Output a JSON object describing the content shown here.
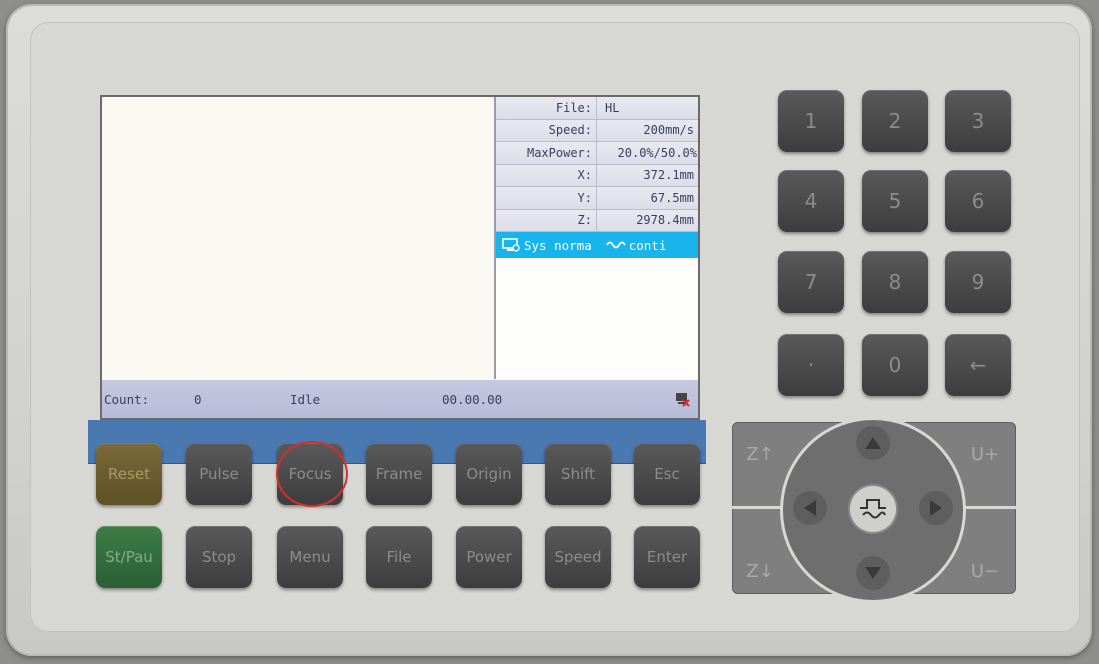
{
  "screen": {
    "info": [
      {
        "label": "File:",
        "value": "HL",
        "align": "left"
      },
      {
        "label": "Speed:",
        "value": "200mm/s"
      },
      {
        "label": "MaxPower:",
        "value": "20.0%/50.0%"
      },
      {
        "label": "X:",
        "value": "372.1mm"
      },
      {
        "label": "Y:",
        "value": "67.5mm"
      },
      {
        "label": "Z:",
        "value": "2978.4mm"
      }
    ],
    "status": {
      "sys": "Sys norma",
      "mode": "conti"
    },
    "statusline": {
      "count_label": "Count:",
      "count_value": "0",
      "state": "Idle",
      "time": "00.00.00"
    }
  },
  "keys": {
    "row1": [
      "Reset",
      "Pulse",
      "Focus",
      "Frame",
      "Origin",
      "Shift",
      "Esc"
    ],
    "row2": [
      "St/Pau",
      "Stop",
      "Menu",
      "File",
      "Power",
      "Speed",
      "Enter"
    ],
    "numpad": [
      "1",
      "2",
      "3",
      "4",
      "5",
      "6",
      "7",
      "8",
      "9",
      "·",
      "0",
      "←"
    ],
    "dpad": {
      "z_up": "Z↑",
      "z_down": "Z↓",
      "u_plus": "U+",
      "u_minus": "U−"
    }
  },
  "colors": {
    "status_bar": "#19b4ec",
    "reset_key": "#6e5f30",
    "stpau_key": "#2f6a3a",
    "key": "#484848"
  }
}
